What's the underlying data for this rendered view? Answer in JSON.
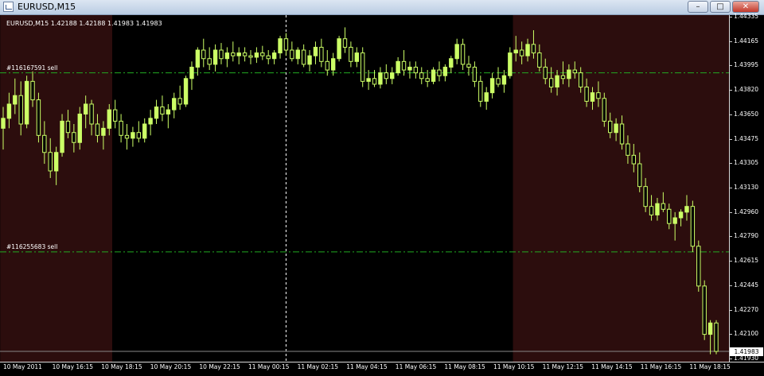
{
  "window": {
    "title": "EURUSD,M15",
    "buttons": {
      "minimize": "–",
      "maximize": "□",
      "close": "✕"
    }
  },
  "symbol_info": "EURUSD,M15  1.42188 1.42188 1.41983 1.41983",
  "orders": [
    {
      "label": "#116167591 sell",
      "price": 1.4394
    },
    {
      "label": "#116255683 sell",
      "price": 1.4268
    }
  ],
  "current_price": "1.41983",
  "colors": {
    "background": "#000000",
    "shade": "#2c0d0d",
    "candle_up": "#ccff66",
    "order_line": "#22aa22",
    "crosshair": "#ffffff"
  },
  "price_axis": [
    "1.44335",
    "1.44165",
    "1.43995",
    "1.43820",
    "1.43650",
    "1.43475",
    "1.43305",
    "1.43130",
    "1.42960",
    "1.42790",
    "1.42615",
    "1.42445",
    "1.42270",
    "1.42100",
    "1.41930"
  ],
  "time_axis": [
    "10 May 2011",
    "10 May 16:15",
    "10 May 18:15",
    "10 May 20:15",
    "10 May 22:15",
    "11 May 00:15",
    "11 May 02:15",
    "11 May 04:15",
    "11 May 06:15",
    "11 May 08:15",
    "11 May 10:15",
    "11 May 12:15",
    "11 May 14:15",
    "11 May 16:15",
    "11 May 18:15"
  ],
  "chart_data": {
    "type": "candlestick",
    "symbol": "EURUSD",
    "timeframe": "M15",
    "ylim": [
      1.4193,
      1.44335
    ],
    "shaded_sessions": [
      [
        0,
        18
      ],
      [
        87,
        135
      ]
    ],
    "crosshair_x_index": 48,
    "ohlc": [
      [
        1.4355,
        1.437,
        1.434,
        1.4362
      ],
      [
        1.4362,
        1.438,
        1.4355,
        1.4372
      ],
      [
        1.4372,
        1.439,
        1.4365,
        1.4378
      ],
      [
        1.4378,
        1.4388,
        1.435,
        1.4358
      ],
      [
        1.4358,
        1.4392,
        1.4355,
        1.4388
      ],
      [
        1.4388,
        1.4395,
        1.437,
        1.4375
      ],
      [
        1.4375,
        1.438,
        1.4345,
        1.435
      ],
      [
        1.435,
        1.436,
        1.433,
        1.4338
      ],
      [
        1.4338,
        1.4348,
        1.432,
        1.4325
      ],
      [
        1.4325,
        1.4342,
        1.4315,
        1.4338
      ],
      [
        1.4338,
        1.4365,
        1.4335,
        1.436
      ],
      [
        1.436,
        1.4368,
        1.4348,
        1.4352
      ],
      [
        1.4352,
        1.4358,
        1.4338,
        1.4345
      ],
      [
        1.4345,
        1.437,
        1.434,
        1.4365
      ],
      [
        1.4365,
        1.4378,
        1.4355,
        1.4372
      ],
      [
        1.4372,
        1.4375,
        1.435,
        1.4358
      ],
      [
        1.4358,
        1.4365,
        1.4345,
        1.435
      ],
      [
        1.435,
        1.436,
        1.434,
        1.4355
      ],
      [
        1.4355,
        1.4372,
        1.435,
        1.4368
      ],
      [
        1.4368,
        1.4375,
        1.4355,
        1.436
      ],
      [
        1.436,
        1.4365,
        1.4345,
        1.435
      ],
      [
        1.435,
        1.4358,
        1.434,
        1.4348
      ],
      [
        1.4348,
        1.4356,
        1.4342,
        1.4352
      ],
      [
        1.4352,
        1.436,
        1.4345,
        1.4348
      ],
      [
        1.4348,
        1.4362,
        1.4345,
        1.4358
      ],
      [
        1.4358,
        1.4368,
        1.435,
        1.4362
      ],
      [
        1.4362,
        1.4375,
        1.4358,
        1.437
      ],
      [
        1.437,
        1.4378,
        1.436,
        1.4365
      ],
      [
        1.4365,
        1.4372,
        1.4355,
        1.4368
      ],
      [
        1.4368,
        1.438,
        1.4362,
        1.4376
      ],
      [
        1.4376,
        1.4385,
        1.4368,
        1.4372
      ],
      [
        1.4372,
        1.4392,
        1.437,
        1.439
      ],
      [
        1.439,
        1.4402,
        1.4382,
        1.4398
      ],
      [
        1.4398,
        1.4412,
        1.4392,
        1.441
      ],
      [
        1.441,
        1.4418,
        1.4398,
        1.4404
      ],
      [
        1.4404,
        1.4412,
        1.4396,
        1.44
      ],
      [
        1.44,
        1.4414,
        1.4395,
        1.441
      ],
      [
        1.441,
        1.4415,
        1.44,
        1.4404
      ],
      [
        1.4404,
        1.4412,
        1.4398,
        1.4408
      ],
      [
        1.4408,
        1.4416,
        1.4402,
        1.4406
      ],
      [
        1.4406,
        1.4412,
        1.44,
        1.4408
      ],
      [
        1.4408,
        1.4412,
        1.4402,
        1.4406
      ],
      [
        1.4406,
        1.441,
        1.44,
        1.4405
      ],
      [
        1.4405,
        1.4412,
        1.4401,
        1.4408
      ],
      [
        1.4408,
        1.4413,
        1.4403,
        1.4406
      ],
      [
        1.4406,
        1.441,
        1.44,
        1.4404
      ],
      [
        1.4404,
        1.441,
        1.44,
        1.4408
      ],
      [
        1.4408,
        1.442,
        1.4404,
        1.4418
      ],
      [
        1.4418,
        1.4422,
        1.4406,
        1.441
      ],
      [
        1.441,
        1.4416,
        1.4402,
        1.4404
      ],
      [
        1.4404,
        1.4412,
        1.44,
        1.441
      ],
      [
        1.441,
        1.4414,
        1.4398,
        1.44
      ],
      [
        1.44,
        1.441,
        1.4395,
        1.4406
      ],
      [
        1.4406,
        1.4416,
        1.44,
        1.4412
      ],
      [
        1.4412,
        1.4418,
        1.4398,
        1.4402
      ],
      [
        1.4402,
        1.441,
        1.4392,
        1.4396
      ],
      [
        1.4396,
        1.4408,
        1.4392,
        1.4404
      ],
      [
        1.4404,
        1.442,
        1.4402,
        1.4418
      ],
      [
        1.4418,
        1.4426,
        1.4408,
        1.4412
      ],
      [
        1.4412,
        1.4416,
        1.4398,
        1.4402
      ],
      [
        1.4402,
        1.4412,
        1.4398,
        1.4408
      ],
      [
        1.4408,
        1.4412,
        1.4384,
        1.4388
      ],
      [
        1.4388,
        1.4396,
        1.4382,
        1.439
      ],
      [
        1.439,
        1.4396,
        1.4384,
        1.4386
      ],
      [
        1.4386,
        1.4398,
        1.4383,
        1.4394
      ],
      [
        1.4394,
        1.44,
        1.4386,
        1.439
      ],
      [
        1.439,
        1.4398,
        1.4386,
        1.4394
      ],
      [
        1.4394,
        1.4405,
        1.4392,
        1.4402
      ],
      [
        1.4402,
        1.441,
        1.4392,
        1.4396
      ],
      [
        1.4396,
        1.4402,
        1.439,
        1.4398
      ],
      [
        1.4398,
        1.4402,
        1.439,
        1.4394
      ],
      [
        1.4394,
        1.4398,
        1.4386,
        1.439
      ],
      [
        1.439,
        1.4396,
        1.4384,
        1.4388
      ],
      [
        1.4388,
        1.4398,
        1.4386,
        1.4396
      ],
      [
        1.4396,
        1.4402,
        1.4388,
        1.4392
      ],
      [
        1.4392,
        1.44,
        1.4388,
        1.4398
      ],
      [
        1.4398,
        1.4406,
        1.4394,
        1.4404
      ],
      [
        1.4404,
        1.4418,
        1.44,
        1.4414
      ],
      [
        1.4414,
        1.4418,
        1.4396,
        1.44
      ],
      [
        1.44,
        1.4406,
        1.4392,
        1.4398
      ],
      [
        1.4398,
        1.4402,
        1.4384,
        1.4388
      ],
      [
        1.4388,
        1.4392,
        1.437,
        1.4374
      ],
      [
        1.4374,
        1.4384,
        1.4368,
        1.438
      ],
      [
        1.438,
        1.4394,
        1.4376,
        1.439
      ],
      [
        1.439,
        1.4398,
        1.4384,
        1.4386
      ],
      [
        1.4386,
        1.4396,
        1.438,
        1.4392
      ],
      [
        1.4392,
        1.4412,
        1.439,
        1.4408
      ],
      [
        1.4408,
        1.442,
        1.4402,
        1.441
      ],
      [
        1.441,
        1.4416,
        1.44,
        1.4406
      ],
      [
        1.4406,
        1.4418,
        1.4402,
        1.4414
      ],
      [
        1.4414,
        1.4424,
        1.4404,
        1.4408
      ],
      [
        1.4408,
        1.4414,
        1.4395,
        1.4398
      ],
      [
        1.4398,
        1.4404,
        1.4386,
        1.439
      ],
      [
        1.439,
        1.4398,
        1.438,
        1.4384
      ],
      [
        1.4384,
        1.4396,
        1.4378,
        1.4392
      ],
      [
        1.4392,
        1.4402,
        1.4386,
        1.439
      ],
      [
        1.439,
        1.44,
        1.4384,
        1.4396
      ],
      [
        1.4396,
        1.4402,
        1.439,
        1.4394
      ],
      [
        1.4394,
        1.4398,
        1.438,
        1.4384
      ],
      [
        1.4384,
        1.439,
        1.437,
        1.4374
      ],
      [
        1.4374,
        1.4384,
        1.4368,
        1.438
      ],
      [
        1.438,
        1.4388,
        1.437,
        1.4376
      ],
      [
        1.4376,
        1.438,
        1.4356,
        1.436
      ],
      [
        1.436,
        1.4366,
        1.4348,
        1.4352
      ],
      [
        1.4352,
        1.4362,
        1.4346,
        1.4358
      ],
      [
        1.4358,
        1.4364,
        1.434,
        1.4344
      ],
      [
        1.4344,
        1.435,
        1.433,
        1.4336
      ],
      [
        1.4336,
        1.4344,
        1.4324,
        1.433
      ],
      [
        1.433,
        1.4338,
        1.431,
        1.4314
      ],
      [
        1.4314,
        1.432,
        1.4296,
        1.43
      ],
      [
        1.43,
        1.4308,
        1.429,
        1.4294
      ],
      [
        1.4294,
        1.4306,
        1.429,
        1.4302
      ],
      [
        1.4302,
        1.431,
        1.4296,
        1.4298
      ],
      [
        1.4298,
        1.4302,
        1.4284,
        1.4288
      ],
      [
        1.4288,
        1.4296,
        1.4276,
        1.4292
      ],
      [
        1.4292,
        1.4298,
        1.4286,
        1.4296
      ],
      [
        1.4296,
        1.4308,
        1.429,
        1.43
      ],
      [
        1.43,
        1.4304,
        1.4268,
        1.4272
      ],
      [
        1.4272,
        1.4276,
        1.424,
        1.4244
      ],
      [
        1.4244,
        1.4248,
        1.4206,
        1.421
      ],
      [
        1.421,
        1.422,
        1.4196,
        1.4218
      ],
      [
        1.4218,
        1.422,
        1.4196,
        1.4198
      ]
    ]
  }
}
